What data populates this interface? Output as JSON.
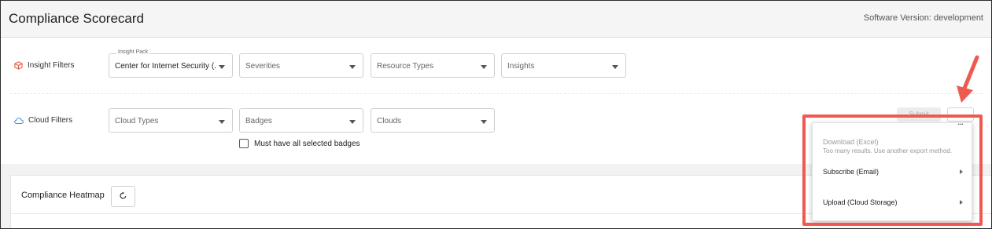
{
  "header": {
    "title": "Compliance Scorecard",
    "version": "Software Version: development"
  },
  "insight_filters": {
    "label": "Insight Filters",
    "insight_pack": {
      "floating_label": "Insight Pack",
      "value": "Center for Internet Security (..."
    },
    "severities": "Severities",
    "resource_types": "Resource Types",
    "insights": "Insights"
  },
  "cloud_filters": {
    "label": "Cloud Filters",
    "cloud_types": "Cloud Types",
    "badges": "Badges",
    "clouds": "Clouds",
    "must_have_badges": "Must have all selected badges"
  },
  "actions": {
    "submit": "Submit",
    "more": "..."
  },
  "menu": {
    "download_label": "Download (Excel)",
    "download_note": "Too many results. Use another export method.",
    "subscribe_label": "Subscribe (Email)",
    "upload_label": "Upload (Cloud Storage)"
  },
  "heatmap": {
    "title": "Compliance Heatmap"
  },
  "colors": {
    "highlight": "#ee5a4f",
    "insight_icon": "#e25b45",
    "cloud_icon": "#2f7fd6"
  },
  "icons": {
    "insight": "cube-icon",
    "cloud": "cloud-icon",
    "reset": "refresh-icon"
  }
}
